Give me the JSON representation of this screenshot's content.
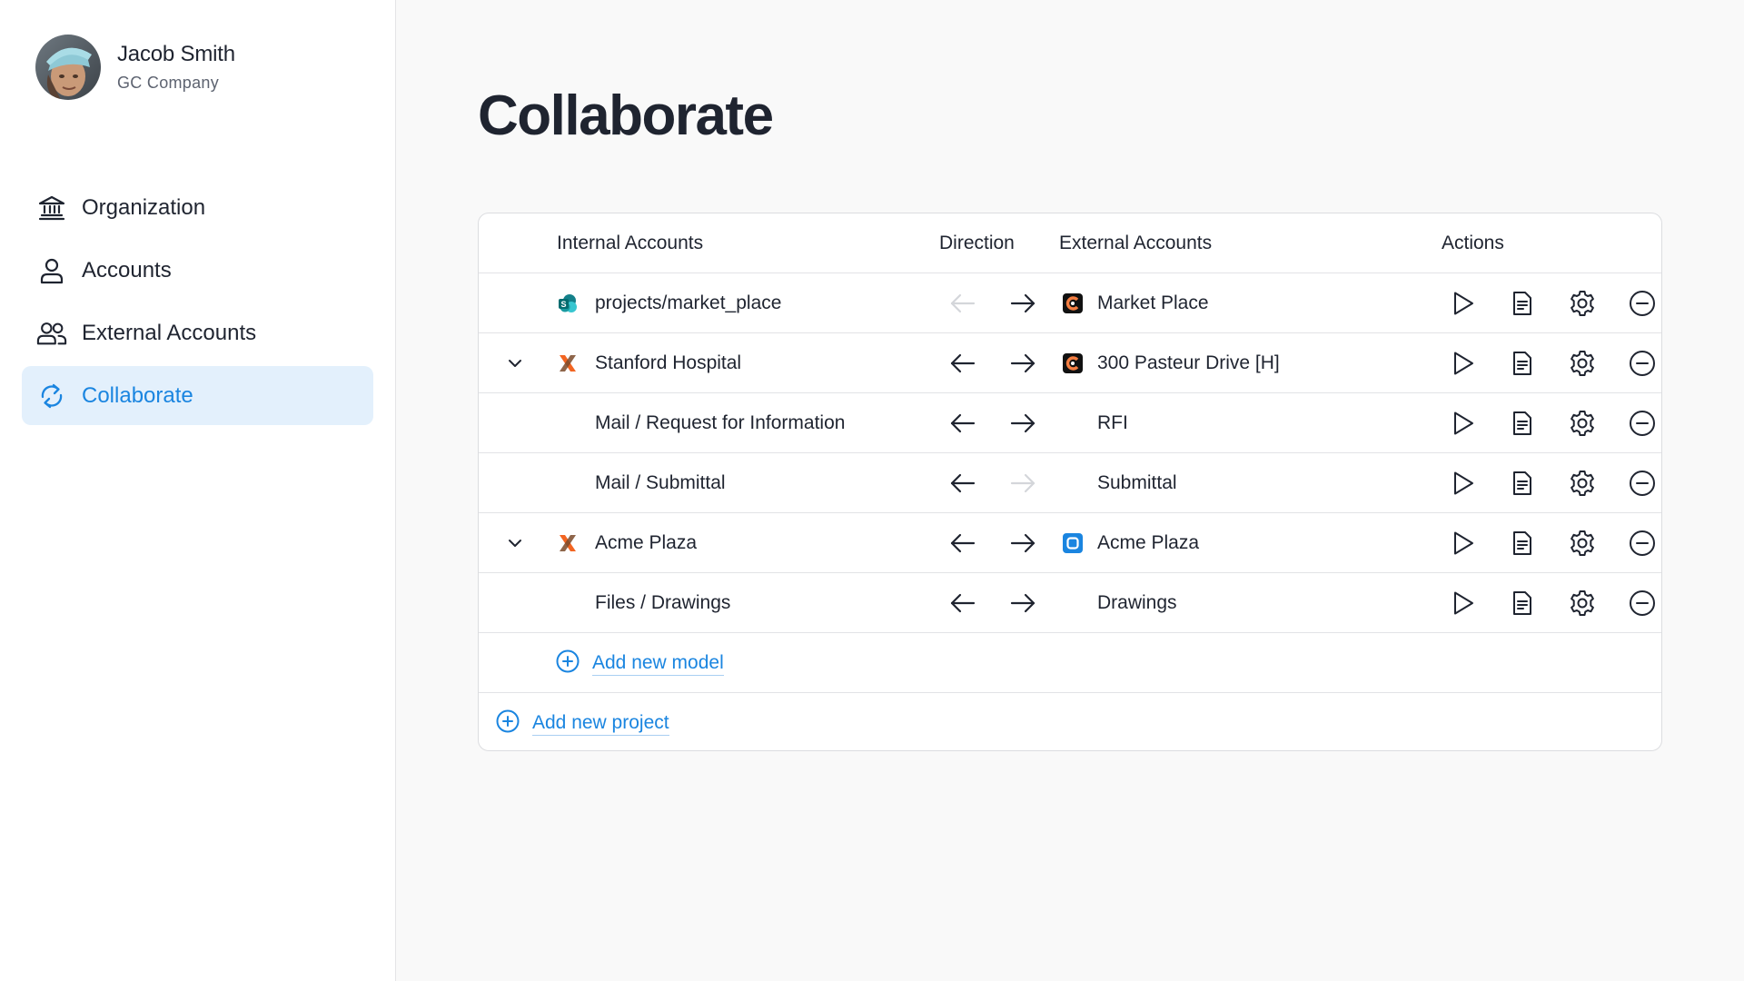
{
  "user": {
    "name": "Jacob Smith",
    "company": "GC Company"
  },
  "nav": {
    "items": [
      {
        "label": "Organization",
        "icon": "bank-icon"
      },
      {
        "label": "Accounts",
        "icon": "user-icon"
      },
      {
        "label": "External Accounts",
        "icon": "users-icon"
      },
      {
        "label": "Collaborate",
        "icon": "sync-icon",
        "active": true
      }
    ]
  },
  "page": {
    "title": "Collaborate"
  },
  "table": {
    "headers": {
      "internal": "Internal Accounts",
      "direction": "Direction",
      "external": "External Accounts",
      "actions": "Actions"
    },
    "rows": [
      {
        "internal": "projects/market_place",
        "internal_icon": "sharepoint-icon",
        "external": "Market Place",
        "external_icon": "procore-icon",
        "left_arrow_enabled": false,
        "right_arrow_enabled": true,
        "expandable": false
      },
      {
        "internal": "Stanford Hospital",
        "internal_icon": "x-logo-icon",
        "external": "300 Pasteur Drive [H]",
        "external_icon": "procore-icon",
        "left_arrow_enabled": true,
        "right_arrow_enabled": true,
        "expandable": true
      },
      {
        "internal": "Mail / Request for Information",
        "external": "RFI",
        "left_arrow_enabled": true,
        "right_arrow_enabled": true,
        "expandable": false
      },
      {
        "internal": "Mail / Submittal",
        "external": "Submittal",
        "left_arrow_enabled": true,
        "right_arrow_enabled": false,
        "expandable": false
      },
      {
        "internal": "Acme Plaza",
        "internal_icon": "x-logo-icon",
        "external": "Acme Plaza",
        "external_icon": "autodesk-icon",
        "left_arrow_enabled": true,
        "right_arrow_enabled": true,
        "expandable": true
      },
      {
        "internal": "Files / Drawings",
        "external": "Drawings",
        "left_arrow_enabled": true,
        "right_arrow_enabled": true,
        "expandable": false
      }
    ],
    "add_model": "Add new model",
    "add_project": "Add new project"
  },
  "colors": {
    "accent": "#1a85e0",
    "active_bg": "#e3f0fc",
    "text": "#1f2430",
    "disabled_arrow": "#d4d6da",
    "procore_orange": "#f47e42",
    "x_logo_orange": "#f26522"
  }
}
